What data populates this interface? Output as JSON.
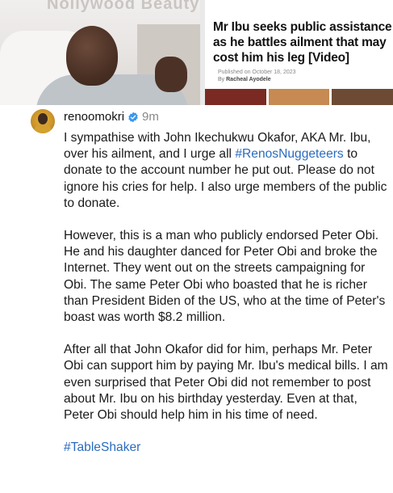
{
  "news": {
    "faded_title": "Nollywood Beauty",
    "headline": "Mr Ibu seeks public assistance as he battles ailment that may cost him his leg [Video]",
    "published": "Published on October 18, 2023",
    "byline_prefix": "By ",
    "byline_author": "Racheal Ayodele"
  },
  "post": {
    "username": "renoomokri",
    "time": "9m",
    "p1_a": "I sympathise with John Ikechukwu Okafor, AKA Mr. Ibu, over his ailment, and I urge all ",
    "p1_tag": "#RenosNuggeteers",
    "p1_b": " to donate to the account number he put out. Please do not ignore his cries for help. I also urge members of the public to donate.",
    "p2": "However, this is a man who publicly endorsed Peter Obi. He and his daughter danced for Peter Obi and broke the Internet. They went out on the streets campaigning for Obi. The same Peter Obi who boasted that he is richer than President Biden of the US, who at the time of Peter's boast was worth $8.2 million.",
    "p3": "After all that John Okafor did for him, perhaps Mr. Peter Obi can support him by paying Mr. Ibu's medical bills. I am even surprised that Peter Obi did not remember to post about Mr. Ibu on his birthday yesterday. Even at that, Peter Obi should help him in his time of need.",
    "tag": "#TableShaker"
  },
  "colors": {
    "hashtag": "#2b6bbf",
    "verified": "#3897f0"
  }
}
